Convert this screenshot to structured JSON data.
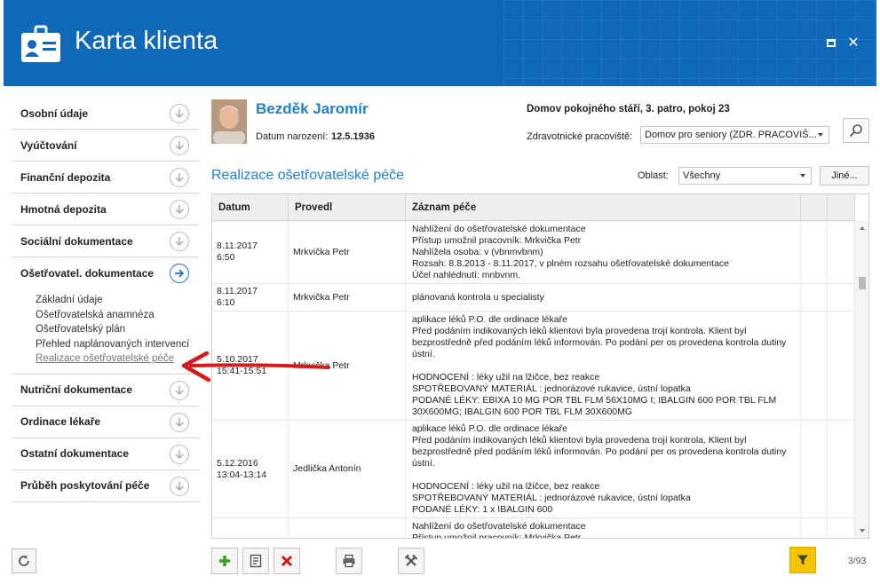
{
  "window": {
    "title": "Karta klienta",
    "maximize_icon": "maximize-icon",
    "close_icon": "close-icon",
    "accent_color": "#1068b8"
  },
  "sidebar": {
    "sections": [
      {
        "label": "Osobní údaje"
      },
      {
        "label": "Vyúčtování"
      },
      {
        "label": "Finanční depozita"
      },
      {
        "label": "Hmotná depozita"
      },
      {
        "label": "Sociální dokumentace"
      },
      {
        "label": "Ošetřovatel. dokumentace",
        "expanded": true
      },
      {
        "label": "Nutriční dokumentace"
      },
      {
        "label": "Ordinace lékaře"
      },
      {
        "label": "Ostatní dokumentace"
      },
      {
        "label": "Průběh poskytování péče"
      }
    ],
    "subitems": [
      {
        "label": "Základní údaje"
      },
      {
        "label": "Ošetřovatelská anamnéza"
      },
      {
        "label": "Ošetřovatelský plán"
      },
      {
        "label": "Přehled naplánovaných intervencí"
      },
      {
        "label": "Realizace ošetřovatelské péče",
        "current": true
      }
    ]
  },
  "patient": {
    "name": "Bezděk Jaromír",
    "dob_label": "Datum narození:",
    "dob": "12.5.1936",
    "facility": "Domov pokojného stáří, 3. patro, pokoj 23",
    "workplace_label": "Zdravotnické pracoviště:",
    "workplace_value": "Domov pro seniory (ZDR. PRACOVIŠ..."
  },
  "section": {
    "title": "Realizace ošetřovatelské péče",
    "area_label": "Oblast:",
    "area_value": "Všechny",
    "other_button": "Jiné..."
  },
  "grid": {
    "columns": [
      "Datum",
      "Provedl",
      "Záznam péče",
      "",
      ""
    ],
    "rows": [
      {
        "date": "8.11.2017\n6:50",
        "who": "Mrkvička Petr",
        "record": "Nahlížení do ošetřovatelské dokumentace\nPřístup umožnil pracovník: Mrkvička Petr\nNahlížela osoba: v (vbnmvbnm)\nRozsah: 8.8.2013 - 8.11.2017, v plném rozsahu ošetřovatelské dokumentace\nÚčel nahlédnutí: mnbvnm."
      },
      {
        "date": "8.11.2017\n6:10",
        "who": "Mrkvička Petr",
        "record": "plánovaná kontrola u specialisty"
      },
      {
        "date": "5.10.2017\n15:41-15:51",
        "who": "Mrkvička Petr",
        "record": "aplikace léků P.O. dle ordinace lékaře\nPřed podáním indikovaných léků klientovi byla provedena trojí kontrola. Klient byl bezprostředně před podáním léků informován. Po podání per os provedena kontrola dutiny ústní.\n\nHODNOCENÍ : léky užil na lžičce, bez reakce\nSPOTŘEBOVANÝ MATERIÁL : jednorázové rukavice, ústní lopatka\nPODANÉ LÉKY: EBIXA 10 MG POR TBL FLM 56X10MG I; IBALGIN 600 POR TBL FLM 30X600MG; IBALGIN 600 POR TBL FLM 30X600MG"
      },
      {
        "date": "5.12.2016\n13:04-13:14",
        "who": "Jedlička Antonín",
        "record": "aplikace léků P.O. dle ordinace lékaře\nPřed podáním indikovaných léků klientovi byla provedena trojí kontrola. Klient byl bezprostředně před podáním léků informován. Po podání per os provedena kontrola dutiny ústní.\n\nHODNOCENÍ : léky užil na lžičce, bez reakce\nSPOTŘEBOVANÝ MATERIÁL : jednorázové rukavice, ústní lopatka\nPODANÉ LÉKY: 1 x IBALGIN 600"
      },
      {
        "date": "",
        "who": "",
        "record": "Nahlížení do ošetřovatelské dokumentace\nPřístup umožnil pracovník: Mrkvička Petr"
      }
    ]
  },
  "toolbar": {
    "buttons": [
      "add-icon",
      "edit-note-icon",
      "delete-icon",
      "print-icon",
      "tools-icon"
    ],
    "filter_icon": "filter-icon",
    "filter_color": "#f5c400",
    "page_count": "3/93"
  }
}
